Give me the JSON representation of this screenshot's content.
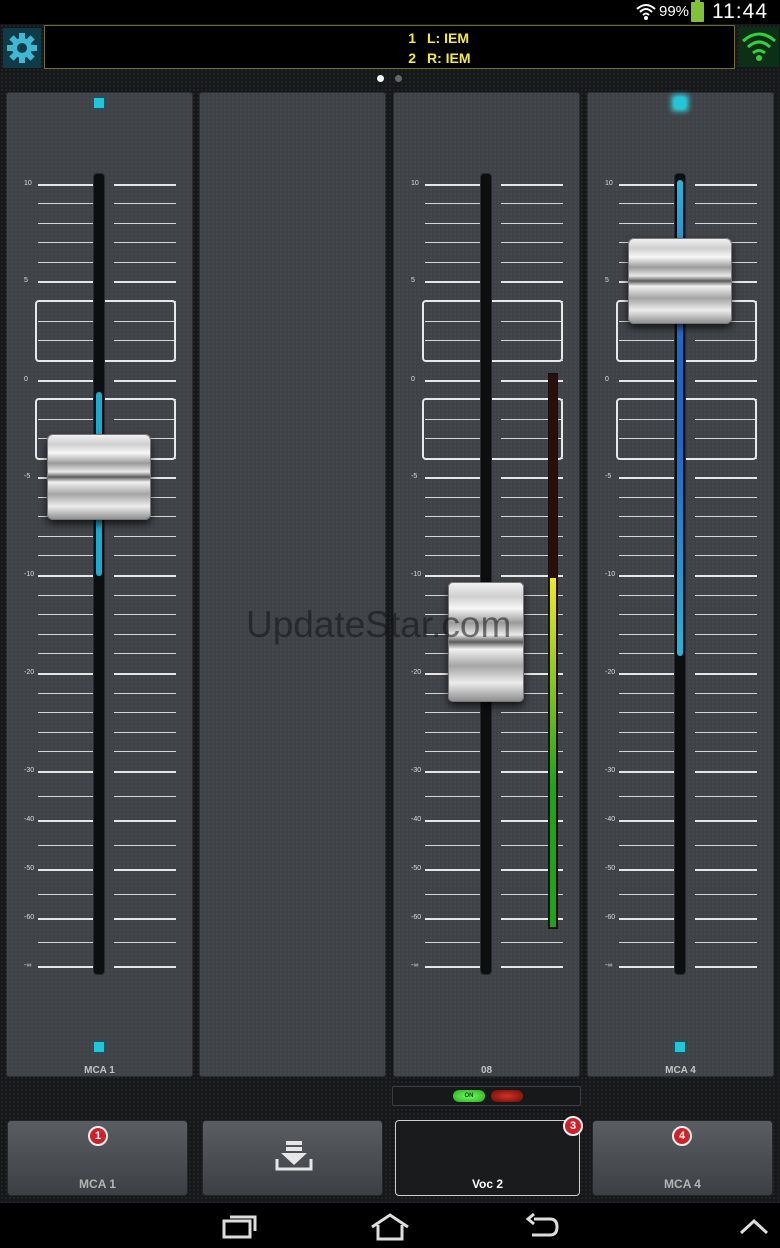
{
  "status_bar": {
    "battery": "99%",
    "time": "11:44"
  },
  "header": {
    "routes": [
      {
        "num": "1",
        "text": "L:  IEM"
      },
      {
        "num": "2",
        "text": "R:  IEM"
      }
    ],
    "pages": 2,
    "active_page": 0
  },
  "scale": {
    "labels": [
      "10",
      "5",
      "0",
      "-5",
      "-10",
      "-20",
      "-30",
      "-40",
      "-50",
      "-60",
      "-∞"
    ]
  },
  "strips": [
    {
      "id": "s1",
      "name": "MCA 1",
      "level_db": -5,
      "fill_color": "#1fa9cf",
      "top_led": "dim",
      "bottom_led": "dim",
      "frames": true
    },
    {
      "id": "s2",
      "name": "",
      "empty": true
    },
    {
      "id": "s3",
      "name": "08",
      "level_db": -15,
      "top_led": "none",
      "bottom_led": "none",
      "frames": true,
      "meter_level": 0.63
    },
    {
      "id": "s4",
      "name": "MCA 4",
      "level_db": 5,
      "fill_color": "#1f66c9",
      "top_led": "glow",
      "bottom_led": "dim",
      "frames": true
    }
  ],
  "mute": {
    "on_label": "ON",
    "off_label": ""
  },
  "banks": [
    {
      "label": "MCA 1",
      "badge": "1",
      "selected": false
    },
    {
      "label": "",
      "icon": "download-icon",
      "selected": false
    },
    {
      "label": "Voc 2",
      "badge": "3",
      "selected": true
    },
    {
      "label": "MCA 4",
      "badge": "4",
      "selected": false
    }
  ],
  "watermark": "UpdateStar.com",
  "colors": {
    "accent": "#20c7d9",
    "route_text": "#f5eb3b",
    "meter_green": "#1fa31a",
    "meter_yellow": "#f0e826"
  }
}
